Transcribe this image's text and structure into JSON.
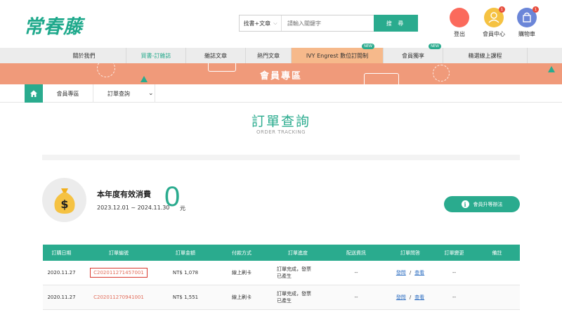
{
  "header": {
    "logo": "常春藤",
    "search": {
      "category": "找書+文章",
      "placeholder": "請輸入關鍵字",
      "button": "搜 尋"
    },
    "actions": [
      {
        "label": "登出",
        "color": "#fb6a5c",
        "badge": ""
      },
      {
        "label": "會員中心",
        "color": "#f5c242",
        "badge": "1"
      },
      {
        "label": "購物車",
        "color": "#6b86d8",
        "badge": "1"
      }
    ]
  },
  "nav": {
    "items": [
      {
        "label": "關於我們",
        "new": ""
      },
      {
        "label": "買書-訂雜誌",
        "new": ""
      },
      {
        "label": "雜誌文章",
        "new": ""
      },
      {
        "label": "熱門文章",
        "new": ""
      },
      {
        "label": "IVY Engrest 數位訂閱制",
        "new": "NEW"
      },
      {
        "label": "會員獨享",
        "new": "NEW"
      },
      {
        "label": "精選線上課程",
        "new": ""
      }
    ]
  },
  "banner": {
    "title": "會員專區"
  },
  "breadcrumb": {
    "level1": "會員專區",
    "level2": "訂單查詢"
  },
  "page": {
    "title": "訂單查詢",
    "subtitle": "ORDER TRACKING"
  },
  "spend": {
    "label": "本年度有效消費",
    "range": "2023.12.01 ~ 2024.11.30",
    "value": "0",
    "unit": "元",
    "button": "會員升等辦法"
  },
  "table": {
    "headers": [
      "訂購日期",
      "訂單編號",
      "訂單金額",
      "付款方式",
      "訂單進度",
      "配送資訊",
      "訂單問答",
      "訂單變更",
      "備註"
    ],
    "rows": [
      {
        "date": "2020.11.27",
        "order_id": "C202011271457001",
        "amount": "NT$ 1,078",
        "payment": "線上刷卡",
        "status_line1": "訂單完成，發票",
        "status_line2": "已產生",
        "delivery": "--",
        "ask": "發問",
        "view": "查看",
        "change": "--",
        "note": ""
      },
      {
        "date": "2020.11.27",
        "order_id": "C202011270941001",
        "amount": "NT$ 1,551",
        "payment": "線上刷卡",
        "status_line1": "訂單完成，發票",
        "status_line2": "已產生",
        "delivery": "--",
        "ask": "發問",
        "view": "查看",
        "change": "--",
        "note": ""
      }
    ]
  },
  "colors": {
    "accent": "#2aab8e",
    "banner": "#f09a7a",
    "ivy_tab": "#f6b98b",
    "order_link": "#e26d5a"
  }
}
